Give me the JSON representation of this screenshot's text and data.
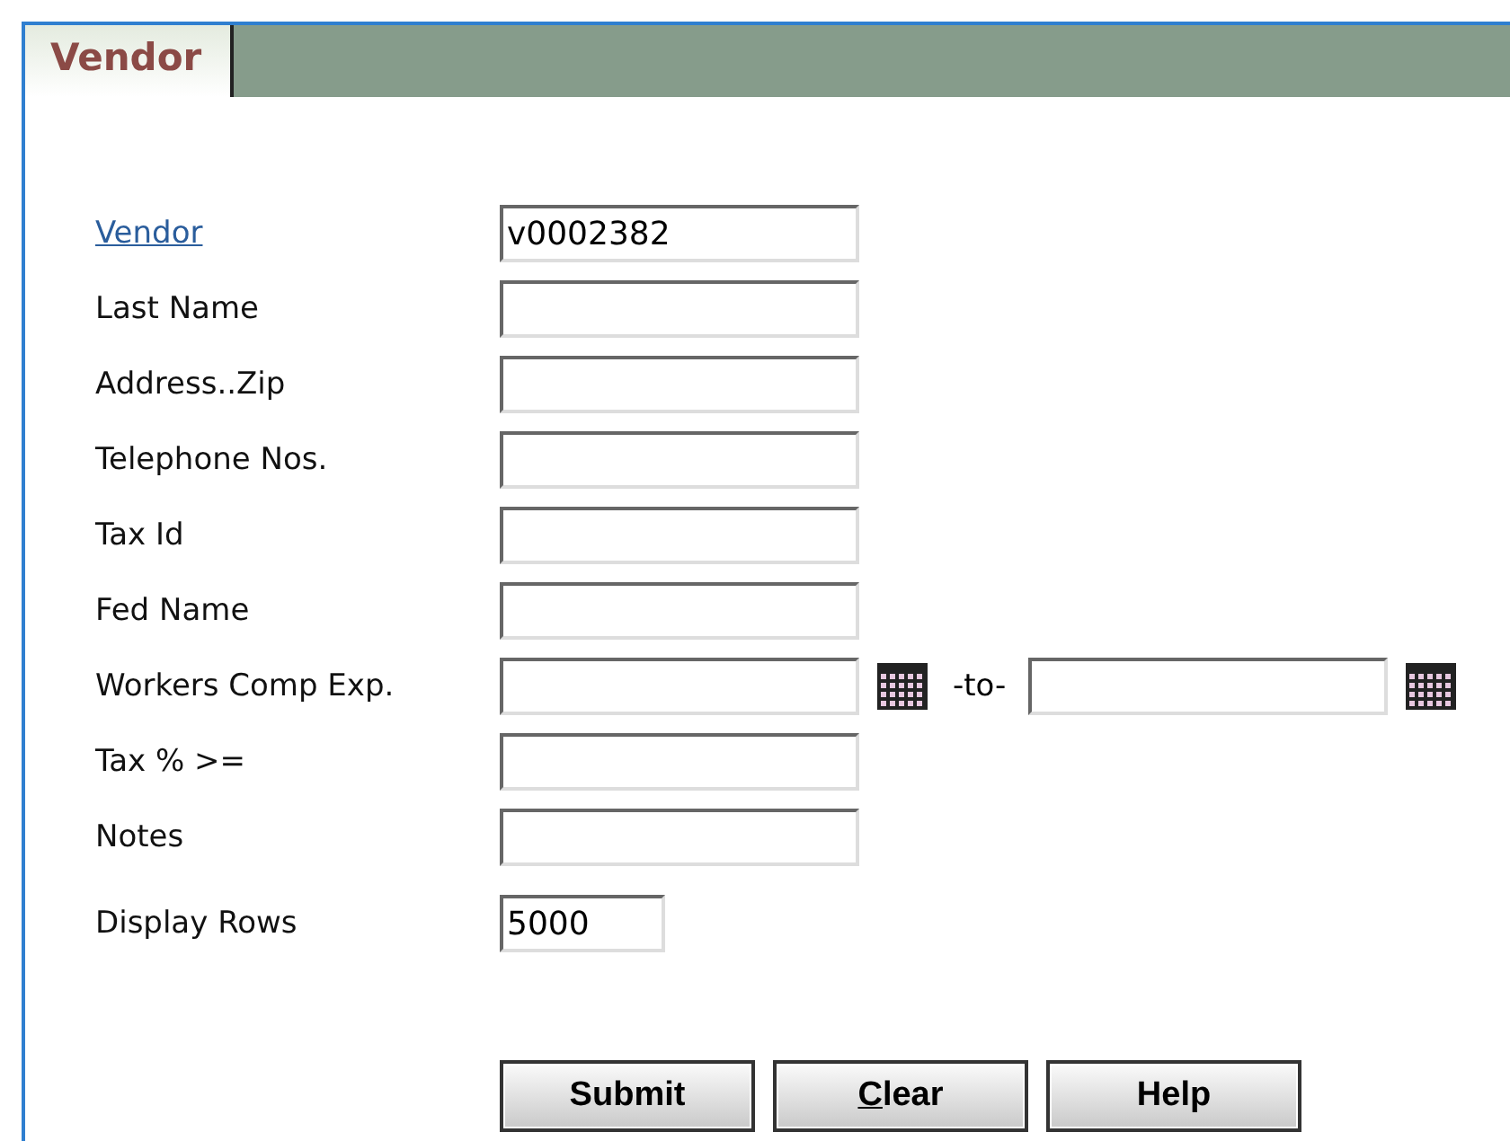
{
  "tab": {
    "label": "Vendor",
    "selected": true
  },
  "fields": [
    {
      "kind": "link",
      "label": "Vendor",
      "value": "v0002382"
    },
    {
      "kind": "text",
      "label": "Last Name"
    },
    {
      "kind": "text",
      "label": "Address..Zip"
    },
    {
      "kind": "text",
      "label": "Telephone Nos."
    },
    {
      "kind": "text",
      "label": "Tax Id"
    },
    {
      "kind": "text",
      "label": "Fed Name"
    },
    {
      "kind": "daterange",
      "label": "Workers Comp Exp.",
      "separator": "-to-"
    },
    {
      "kind": "text",
      "label": "Tax % >="
    },
    {
      "kind": "text",
      "label": "Notes"
    },
    {
      "kind": "short",
      "label": "Display Rows",
      "value": "5000"
    }
  ],
  "buttons": [
    {
      "label": "Submit",
      "underline_first": false
    },
    {
      "label": "Clear",
      "underline_first": true
    },
    {
      "label": "Help",
      "underline_first": false
    }
  ]
}
